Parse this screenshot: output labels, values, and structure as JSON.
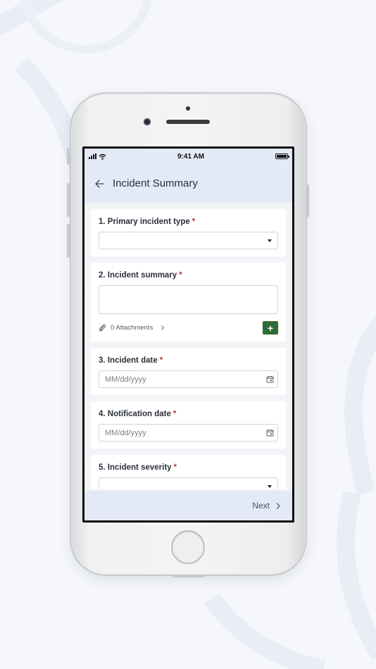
{
  "status_bar": {
    "time": "9:41 AM"
  },
  "app_bar": {
    "title": "Incident Summary",
    "back_icon": "arrow-left-icon"
  },
  "form": {
    "questions": [
      {
        "number_label": "1. Primary incident type",
        "required_mark": "*",
        "type": "dropdown",
        "value": ""
      },
      {
        "number_label": "2. Incident summary",
        "required_mark": "*",
        "type": "textarea",
        "value": "",
        "attachments_label": "0 Attachments"
      },
      {
        "number_label": "3. Incident date",
        "required_mark": "*",
        "type": "date",
        "placeholder": "MM/dd/yyyy"
      },
      {
        "number_label": "4. Notification date",
        "required_mark": "*",
        "type": "date",
        "placeholder": "MM/dd/yyyy"
      },
      {
        "number_label": "5. Incident severity",
        "required_mark": "*",
        "type": "dropdown",
        "value": ""
      }
    ],
    "add_attachment_symbol": "+"
  },
  "footer": {
    "next_label": "Next"
  },
  "colors": {
    "accent_green": "#2f6b35",
    "required_red": "#c0392b",
    "header_bg": "#e4e9f6"
  }
}
